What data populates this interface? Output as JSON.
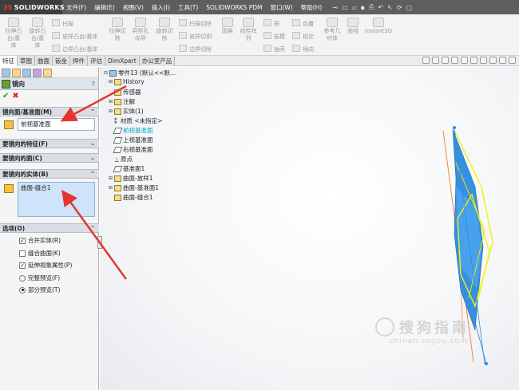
{
  "app": {
    "logo_text": "SOLIDWORKS",
    "logo_prefix": "3S"
  },
  "menu": [
    "文件(F)",
    "编辑(E)",
    "视图(V)",
    "插入(I)",
    "工具(T)",
    "SOLIDWORKS PDM",
    "窗口(W)",
    "帮助(H)"
  ],
  "ribbon": {
    "extrude_boss": "拉伸凸\n台/基\n体",
    "revolve_boss": "旋转凸\n台/基\n体",
    "sweep": "扫描",
    "loft_boss": "放样凸台/基体",
    "boundary_boss": "边界凸台/基体",
    "extrude_cut": "拉伸切\n除",
    "hole_wizard": "异型孔\n向导",
    "revolve_cut": "旋转切\n除",
    "sweep_cut": "扫描切除",
    "loft_cut": "放样切割",
    "boundary_cut": "边界切除",
    "fillet": "圆角",
    "linear_pattern": "线性阵\n列",
    "rib": "筋",
    "draft": "拔模",
    "shell": "抽壳",
    "wrap": "包覆",
    "intersect": "相交",
    "mirror": "镜向",
    "ref_geometry": "参考几\n何体",
    "curves": "曲线",
    "instant3d": "Instant3D"
  },
  "tabs": [
    "特征",
    "草图",
    "曲面",
    "钣金",
    "焊件",
    "评估",
    "DimXpert",
    "办公室产品"
  ],
  "active_tab": 0,
  "pm": {
    "title": "镜向",
    "help": "?",
    "ok": "✔",
    "cancel": "✖",
    "sections": {
      "mirror_face": "镜向面/基准面(M)",
      "features": "要镜向的特征(F)",
      "faces": "要镜向的面(C)",
      "bodies": "要镜向的实体(B)",
      "options": "选项(O)"
    },
    "chevron_up": "⌃",
    "chevron_down": "⌄",
    "mirror_plane_value": "前视基准面",
    "bodies_value": "曲面-缝合1",
    "options": {
      "merge_solids": "合并实体(R)",
      "knit_surfaces": "缝合曲面(K)",
      "propagate": "延伸视象属性(P)",
      "full_preview": "完整预览(F)",
      "partial_preview": "部分预览(T)"
    },
    "option_state": {
      "merge_solids": true,
      "knit_surfaces": false,
      "propagate": true,
      "preview": "partial"
    }
  },
  "tree": {
    "root": "零件13 (默认<<默...",
    "items": [
      "History",
      "传感器",
      "注解",
      "实体(1)",
      "材质 <未指定>",
      "前视基准面",
      "上视基准面",
      "右视基准面",
      "原点",
      "基准面1",
      "曲面-放样1",
      "曲面-基准面1",
      "曲面-缝合1"
    ]
  },
  "watermark": {
    "main": "搜狗指南",
    "sub": "zhinan.sogou.com"
  },
  "colors": {
    "titlebar": "#5d5e60",
    "highlight": "#00a8c8",
    "surface_blue": "#2c8be0",
    "surface_yellow": "#f2f20a",
    "arrow_red": "#e2372f"
  }
}
